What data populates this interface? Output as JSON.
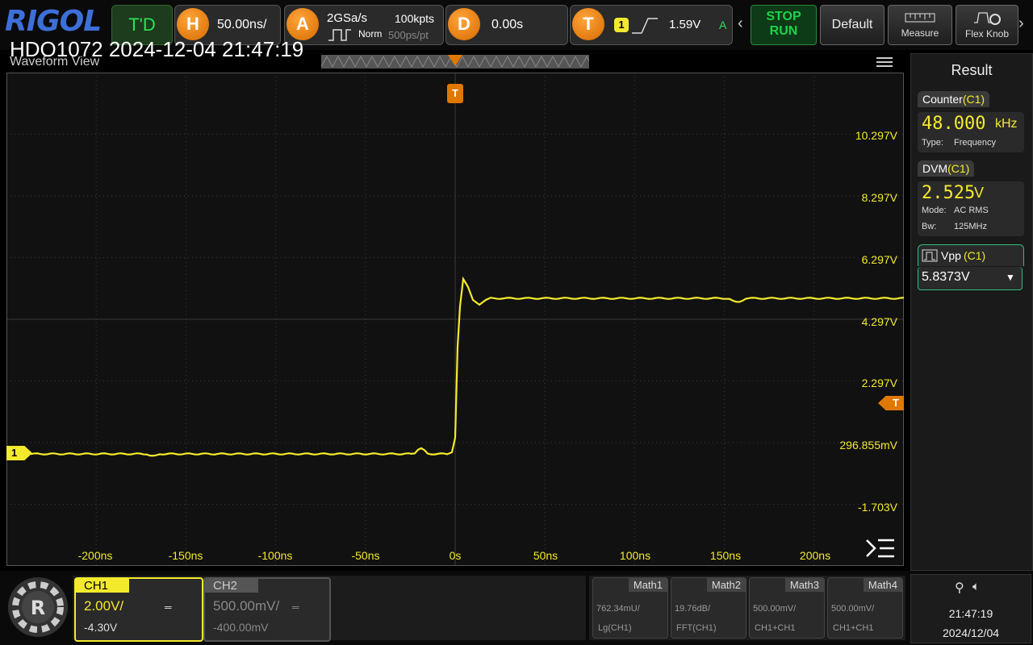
{
  "brand": "RIGOL",
  "header_title": "HDO1072 2024-12-04 21:47:19",
  "view_title": "Waveform View",
  "top": {
    "mode": "T'D",
    "h_label": "H",
    "h_value": "50.00ns/",
    "a_label": "A",
    "sample_rate": "2GSa/s",
    "mem_depth": "100kpts",
    "acq_mode": "Norm",
    "sample_interval": "500ps/pt",
    "d_label": "D",
    "delay": "0.00s",
    "t_label": "T",
    "trig_source": "1",
    "trig_level": "1.59V",
    "trig_mode": "A",
    "stop_label": "STOP",
    "run_label": "RUN",
    "default_label": "Default",
    "measure_label": "Measure",
    "flex_label": "Flex Knob"
  },
  "trigger_marker": "T",
  "ch1_marker": "1",
  "y_labels": [
    "10.297V",
    "8.297V",
    "6.297V",
    "4.297V",
    "2.297V",
    "296.855mV",
    "-1.703V"
  ],
  "x_labels": [
    "-200ns",
    "-150ns",
    "-100ns",
    "-50ns",
    "0s",
    "50ns",
    "100ns",
    "150ns",
    "200ns"
  ],
  "result": {
    "title": "Result",
    "counter": {
      "name": "Counter",
      "src": "(C1)",
      "value": "48.000",
      "unit": "kHz",
      "type_label": "Type:",
      "type": "Frequency"
    },
    "dvm": {
      "name": "DVM",
      "src": "(C1)",
      "value": "2.525",
      "unit": "V",
      "mode_label": "Mode:",
      "mode": "AC RMS",
      "bw_label": "Bw:",
      "bw": "125MHz"
    },
    "vpp": {
      "name": "Vpp",
      "src": "(C1)",
      "value": "5.8373V"
    }
  },
  "channels": [
    {
      "name": "CH1",
      "scale": "2.00V/",
      "offset": "-4.30V",
      "color": "#f4ea2c"
    },
    {
      "name": "CH2",
      "scale": "500.00mV/",
      "offset": "-400.00mV",
      "color": "#888888"
    }
  ],
  "maths": [
    {
      "name": "Math1",
      "scale": "762.34mU/",
      "src": "Lg(CH1)"
    },
    {
      "name": "Math2",
      "scale": "19.76dB/",
      "src": "FFT(CH1)"
    },
    {
      "name": "Math3",
      "scale": "500.00mV/",
      "src": "CH1+CH1"
    },
    {
      "name": "Math4",
      "scale": "500.00mV/",
      "src": "CH1+CH1"
    }
  ],
  "clock": {
    "time": "21:47:19",
    "date": "2024/12/04"
  },
  "colors": {
    "trace": "#f4ea2c",
    "accent": "#e07800",
    "stop_run": "#1fd34a"
  }
}
